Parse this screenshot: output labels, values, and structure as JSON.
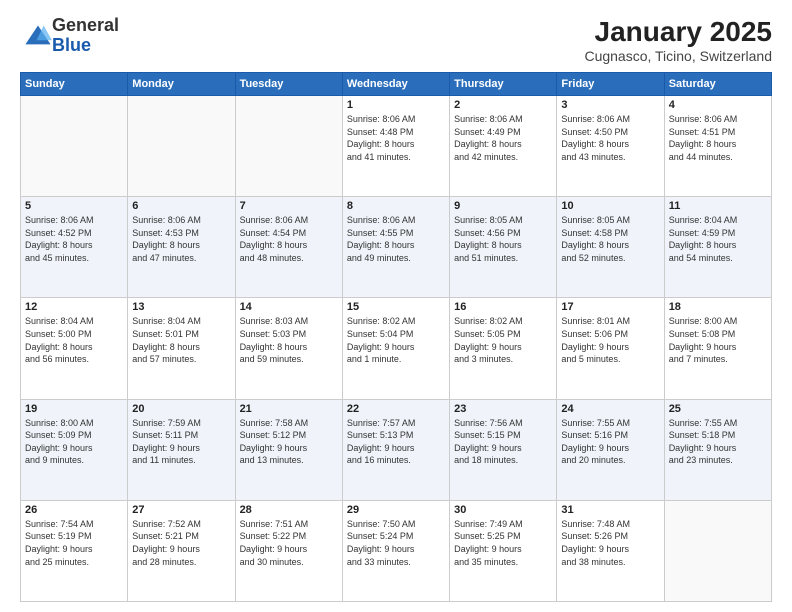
{
  "logo": {
    "general": "General",
    "blue": "Blue"
  },
  "header": {
    "title": "January 2025",
    "location": "Cugnasco, Ticino, Switzerland"
  },
  "weekdays": [
    "Sunday",
    "Monday",
    "Tuesday",
    "Wednesday",
    "Thursday",
    "Friday",
    "Saturday"
  ],
  "weeks": [
    [
      {
        "day": "",
        "info": ""
      },
      {
        "day": "",
        "info": ""
      },
      {
        "day": "",
        "info": ""
      },
      {
        "day": "1",
        "info": "Sunrise: 8:06 AM\nSunset: 4:48 PM\nDaylight: 8 hours\nand 41 minutes."
      },
      {
        "day": "2",
        "info": "Sunrise: 8:06 AM\nSunset: 4:49 PM\nDaylight: 8 hours\nand 42 minutes."
      },
      {
        "day": "3",
        "info": "Sunrise: 8:06 AM\nSunset: 4:50 PM\nDaylight: 8 hours\nand 43 minutes."
      },
      {
        "day": "4",
        "info": "Sunrise: 8:06 AM\nSunset: 4:51 PM\nDaylight: 8 hours\nand 44 minutes."
      }
    ],
    [
      {
        "day": "5",
        "info": "Sunrise: 8:06 AM\nSunset: 4:52 PM\nDaylight: 8 hours\nand 45 minutes."
      },
      {
        "day": "6",
        "info": "Sunrise: 8:06 AM\nSunset: 4:53 PM\nDaylight: 8 hours\nand 47 minutes."
      },
      {
        "day": "7",
        "info": "Sunrise: 8:06 AM\nSunset: 4:54 PM\nDaylight: 8 hours\nand 48 minutes."
      },
      {
        "day": "8",
        "info": "Sunrise: 8:06 AM\nSunset: 4:55 PM\nDaylight: 8 hours\nand 49 minutes."
      },
      {
        "day": "9",
        "info": "Sunrise: 8:05 AM\nSunset: 4:56 PM\nDaylight: 8 hours\nand 51 minutes."
      },
      {
        "day": "10",
        "info": "Sunrise: 8:05 AM\nSunset: 4:58 PM\nDaylight: 8 hours\nand 52 minutes."
      },
      {
        "day": "11",
        "info": "Sunrise: 8:04 AM\nSunset: 4:59 PM\nDaylight: 8 hours\nand 54 minutes."
      }
    ],
    [
      {
        "day": "12",
        "info": "Sunrise: 8:04 AM\nSunset: 5:00 PM\nDaylight: 8 hours\nand 56 minutes."
      },
      {
        "day": "13",
        "info": "Sunrise: 8:04 AM\nSunset: 5:01 PM\nDaylight: 8 hours\nand 57 minutes."
      },
      {
        "day": "14",
        "info": "Sunrise: 8:03 AM\nSunset: 5:03 PM\nDaylight: 8 hours\nand 59 minutes."
      },
      {
        "day": "15",
        "info": "Sunrise: 8:02 AM\nSunset: 5:04 PM\nDaylight: 9 hours\nand 1 minute."
      },
      {
        "day": "16",
        "info": "Sunrise: 8:02 AM\nSunset: 5:05 PM\nDaylight: 9 hours\nand 3 minutes."
      },
      {
        "day": "17",
        "info": "Sunrise: 8:01 AM\nSunset: 5:06 PM\nDaylight: 9 hours\nand 5 minutes."
      },
      {
        "day": "18",
        "info": "Sunrise: 8:00 AM\nSunset: 5:08 PM\nDaylight: 9 hours\nand 7 minutes."
      }
    ],
    [
      {
        "day": "19",
        "info": "Sunrise: 8:00 AM\nSunset: 5:09 PM\nDaylight: 9 hours\nand 9 minutes."
      },
      {
        "day": "20",
        "info": "Sunrise: 7:59 AM\nSunset: 5:11 PM\nDaylight: 9 hours\nand 11 minutes."
      },
      {
        "day": "21",
        "info": "Sunrise: 7:58 AM\nSunset: 5:12 PM\nDaylight: 9 hours\nand 13 minutes."
      },
      {
        "day": "22",
        "info": "Sunrise: 7:57 AM\nSunset: 5:13 PM\nDaylight: 9 hours\nand 16 minutes."
      },
      {
        "day": "23",
        "info": "Sunrise: 7:56 AM\nSunset: 5:15 PM\nDaylight: 9 hours\nand 18 minutes."
      },
      {
        "day": "24",
        "info": "Sunrise: 7:55 AM\nSunset: 5:16 PM\nDaylight: 9 hours\nand 20 minutes."
      },
      {
        "day": "25",
        "info": "Sunrise: 7:55 AM\nSunset: 5:18 PM\nDaylight: 9 hours\nand 23 minutes."
      }
    ],
    [
      {
        "day": "26",
        "info": "Sunrise: 7:54 AM\nSunset: 5:19 PM\nDaylight: 9 hours\nand 25 minutes."
      },
      {
        "day": "27",
        "info": "Sunrise: 7:52 AM\nSunset: 5:21 PM\nDaylight: 9 hours\nand 28 minutes."
      },
      {
        "day": "28",
        "info": "Sunrise: 7:51 AM\nSunset: 5:22 PM\nDaylight: 9 hours\nand 30 minutes."
      },
      {
        "day": "29",
        "info": "Sunrise: 7:50 AM\nSunset: 5:24 PM\nDaylight: 9 hours\nand 33 minutes."
      },
      {
        "day": "30",
        "info": "Sunrise: 7:49 AM\nSunset: 5:25 PM\nDaylight: 9 hours\nand 35 minutes."
      },
      {
        "day": "31",
        "info": "Sunrise: 7:48 AM\nSunset: 5:26 PM\nDaylight: 9 hours\nand 38 minutes."
      },
      {
        "day": "",
        "info": ""
      }
    ]
  ]
}
